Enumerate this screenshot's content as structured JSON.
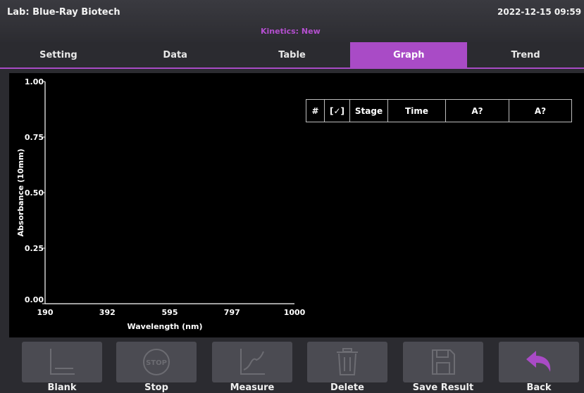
{
  "header": {
    "lab_title": "Lab: Blue-Ray Biotech",
    "mode_title": "Kinetics: New",
    "datetime": "2022-12-15 09:59"
  },
  "tabs": [
    {
      "label": "Setting",
      "active": false
    },
    {
      "label": "Data",
      "active": false
    },
    {
      "label": "Table",
      "active": false
    },
    {
      "label": "Graph",
      "active": true
    },
    {
      "label": "Trend",
      "active": false
    }
  ],
  "table": {
    "headers": [
      "#",
      "[✓]",
      "Stage",
      "Time",
      "A?",
      "A?"
    ]
  },
  "chart_data": {
    "type": "line",
    "xlabel": "Wavelength (nm)",
    "ylabel": "Absorbance (10mm)",
    "x_ticks": [
      "190",
      "392",
      "595",
      "797",
      "1000"
    ],
    "y_ticks": [
      "0.00",
      "0.25",
      "0.50",
      "0.75",
      "1.00"
    ],
    "xlim": [
      190,
      1000
    ],
    "ylim": [
      0,
      1
    ],
    "series": []
  },
  "toolbar": [
    {
      "label": "Blank",
      "icon": "blank-baseline-icon"
    },
    {
      "label": "Stop",
      "icon": "stop-icon"
    },
    {
      "label": "Measure",
      "icon": "measure-curve-icon"
    },
    {
      "label": "Delete",
      "icon": "trash-icon"
    },
    {
      "label": "Save Result",
      "icon": "floppy-disk-icon"
    },
    {
      "label": "Back",
      "icon": "back-arrow-icon"
    }
  ],
  "colors": {
    "accent": "#a94bc6",
    "back_icon": "#a94bc6",
    "background": "#2b2b30",
    "plot_background": "#000000"
  }
}
